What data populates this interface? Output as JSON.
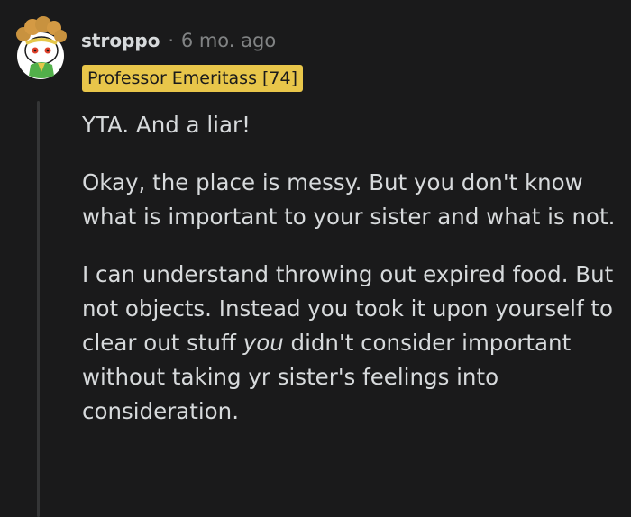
{
  "comment": {
    "username": "stroppo",
    "separator": "·",
    "timestamp": "6 mo. ago",
    "flair": "Professor Emeritass [74]",
    "avatar_icon": "snoo-avatar-icon",
    "paragraphs": {
      "p1": "YTA. And a liar!",
      "p2": "Okay, the place is messy. But you don't know what is important to your sister and what is not.",
      "p3_before": "I can understand throwing out expired food. But not objects. Instead you took it upon yourself to clear out stuff ",
      "p3_emphasis": "you",
      "p3_after": " didn't consider important without taking yr sister's feelings into consideration."
    },
    "colors": {
      "background": "#1a1a1b",
      "text": "#d7dadc",
      "meta": "#818384",
      "flair_bg": "#e8c64a"
    }
  }
}
